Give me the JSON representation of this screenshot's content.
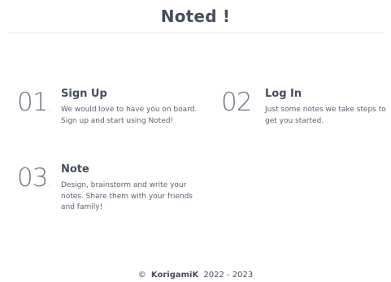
{
  "header": {
    "title": "Noted !"
  },
  "steps": [
    {
      "number": "01",
      "title": "Sign Up",
      "description": "We would love to have you on board. Sign up and start using Noted!"
    },
    {
      "number": "02",
      "title": "Log In",
      "description": "Just some notes we take steps to get you started."
    },
    {
      "number": "03",
      "title": "Note",
      "description": "Design, brainstorm and write your notes. Share them with your friends and family!"
    }
  ],
  "footer": {
    "copyright_symbol": "©",
    "brand": "KorigamiK",
    "years": "2022 - 2023"
  }
}
